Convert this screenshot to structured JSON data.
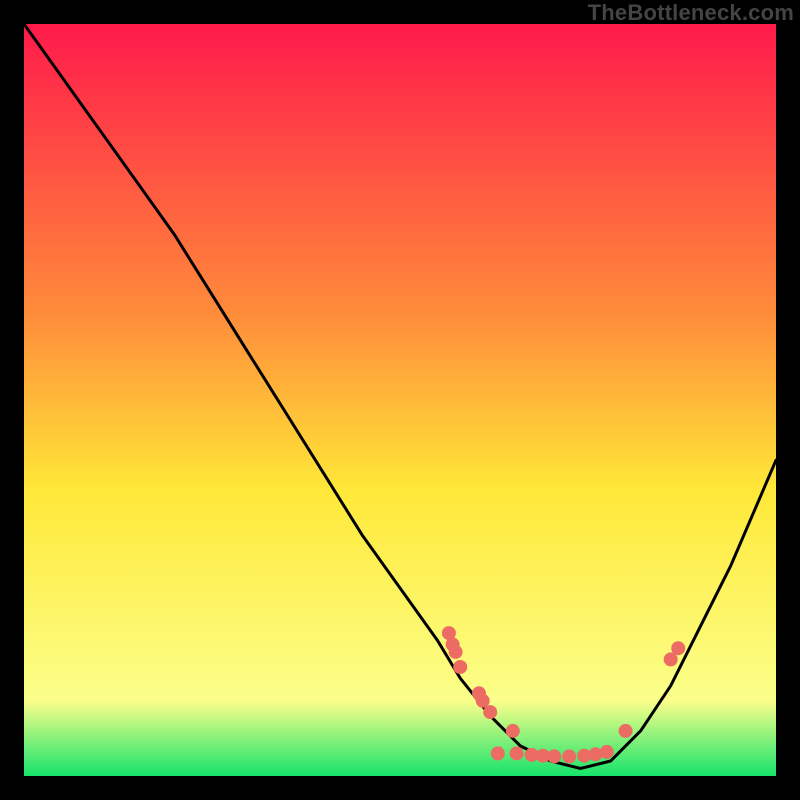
{
  "watermark": "TheBottleneck.com",
  "colors": {
    "bg": "#000000",
    "curve": "#000000",
    "marker": "#ec6b62",
    "grad_top": "#ff1a4b",
    "grad_mid_upper": "#ff8a3a",
    "grad_mid": "#ffe838",
    "grad_low": "#fbff8a",
    "grad_bottom": "#15e36b"
  },
  "chart_data": {
    "type": "line",
    "title": "",
    "xlabel": "",
    "ylabel": "",
    "xlim": [
      0,
      100
    ],
    "ylim": [
      0,
      100
    ],
    "curve": {
      "x": [
        0,
        5,
        10,
        15,
        20,
        25,
        30,
        35,
        40,
        45,
        50,
        55,
        58,
        62,
        66,
        70,
        74,
        78,
        82,
        86,
        90,
        94,
        100
      ],
      "y": [
        100,
        93,
        86,
        79,
        72,
        64,
        56,
        48,
        40,
        32,
        25,
        18,
        13,
        8,
        4,
        2,
        1,
        2,
        6,
        12,
        20,
        28,
        42
      ]
    },
    "markers": [
      {
        "x": 56.5,
        "y": 19.0
      },
      {
        "x": 57.0,
        "y": 17.5
      },
      {
        "x": 57.4,
        "y": 16.5
      },
      {
        "x": 58.0,
        "y": 14.5
      },
      {
        "x": 60.5,
        "y": 11.0
      },
      {
        "x": 61.0,
        "y": 10.0
      },
      {
        "x": 62.0,
        "y": 8.5
      },
      {
        "x": 65.0,
        "y": 6.0
      },
      {
        "x": 63.0,
        "y": 3.0
      },
      {
        "x": 65.5,
        "y": 3.0
      },
      {
        "x": 67.5,
        "y": 2.8
      },
      {
        "x": 69.0,
        "y": 2.7
      },
      {
        "x": 70.5,
        "y": 2.6
      },
      {
        "x": 72.5,
        "y": 2.6
      },
      {
        "x": 74.5,
        "y": 2.7
      },
      {
        "x": 76.0,
        "y": 2.9
      },
      {
        "x": 77.5,
        "y": 3.2
      },
      {
        "x": 80.0,
        "y": 6.0
      },
      {
        "x": 86.0,
        "y": 15.5
      },
      {
        "x": 87.0,
        "y": 17.0
      }
    ]
  }
}
